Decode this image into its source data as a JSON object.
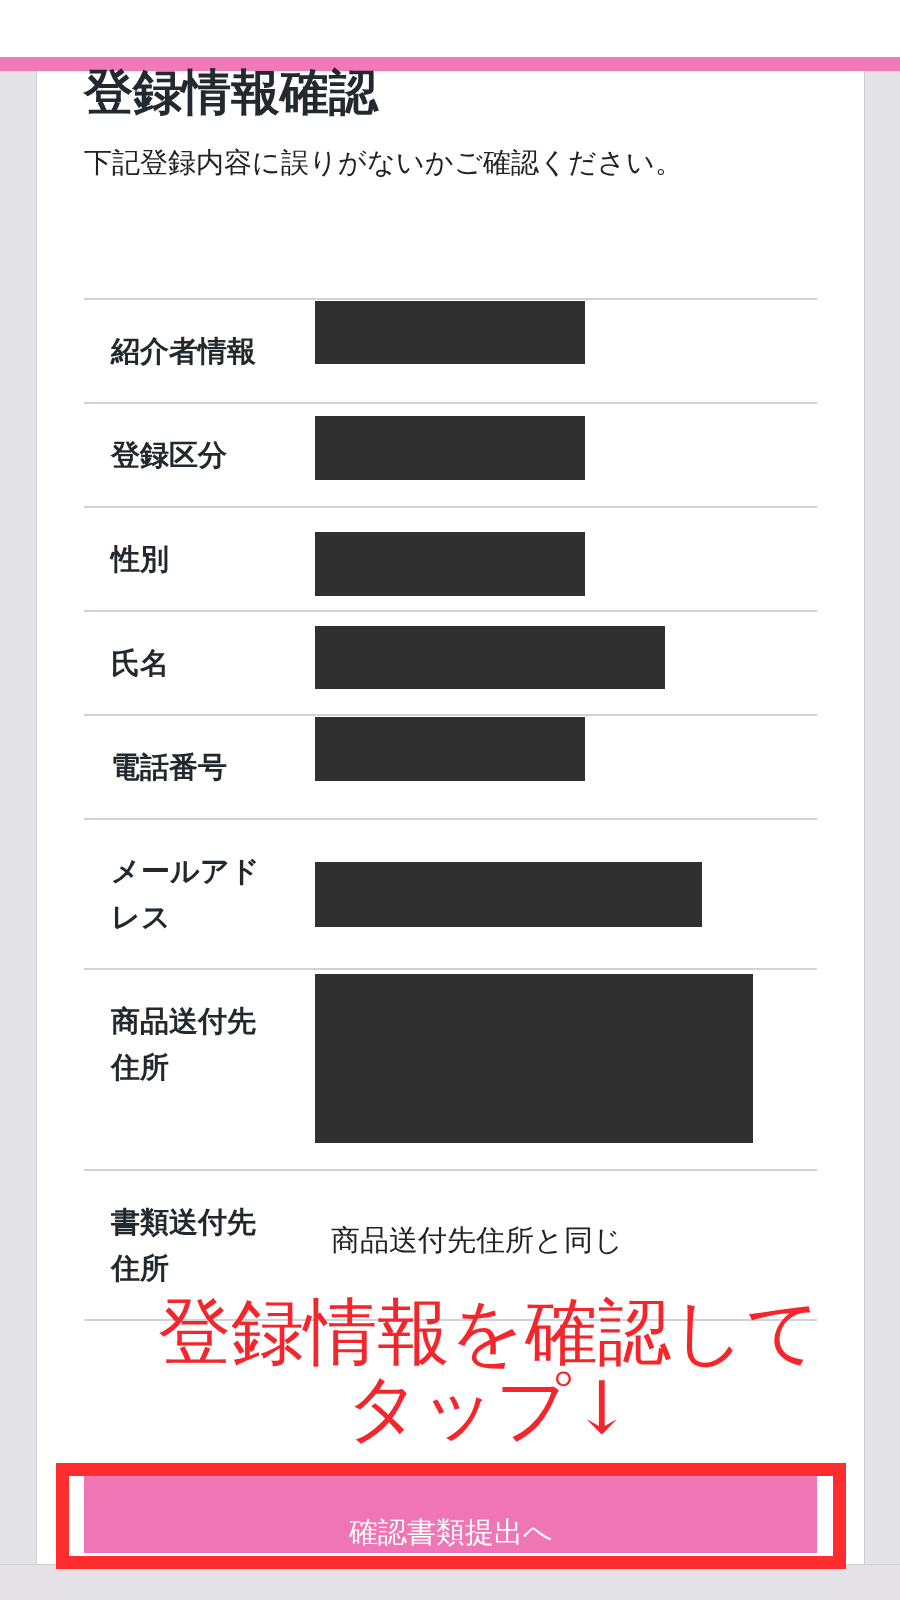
{
  "page": {
    "title": "登録情報確認",
    "description": "下記登録内容に誤りがないかご確認ください。"
  },
  "rows": [
    {
      "label": "紹介者情報",
      "kind": "redacted"
    },
    {
      "label": "登録区分",
      "kind": "redacted"
    },
    {
      "label": "性別",
      "kind": "redacted"
    },
    {
      "label": "氏名",
      "kind": "redacted"
    },
    {
      "label": "電話番号",
      "kind": "redacted"
    },
    {
      "label": "メールアドレス",
      "kind": "redacted"
    },
    {
      "label": "商品送付先住所",
      "kind": "redacted"
    },
    {
      "label": "書類送付先住所",
      "kind": "text",
      "value": "商品送付先住所と同じ"
    }
  ],
  "annotation": {
    "lines": [
      "登録情報を確認して",
      "タップ↓"
    ]
  },
  "submit_button": {
    "label": "確認書類提出へ",
    "highlighted": true
  }
}
